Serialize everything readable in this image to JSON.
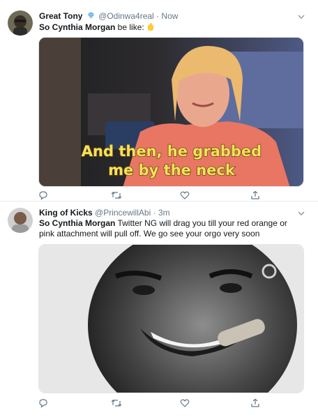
{
  "tweets": [
    {
      "display_name": "Great Tony",
      "handle": "@Odinwa4real",
      "separator": "·",
      "time": "Now",
      "verified_icon": "diamond-icon",
      "text_bold": "So Cynthia Morgan",
      "text_rest": " be like:",
      "emoji_icon": "pointing-hand-icon",
      "media": {
        "caption_line1": "And then, he grabbed",
        "caption_line2": "me by the neck"
      }
    },
    {
      "display_name": "King of Kicks",
      "handle": "@PrincewillAbi",
      "separator": "·",
      "time": "3m",
      "text_bold": "So Cynthia Morgan",
      "text_rest": " Twitter NG will drag you till your red orange or pink attachment will pull off. We go see your orgo very soon"
    }
  ],
  "icons": {
    "reply": "reply-icon",
    "retweet": "retweet-icon",
    "like": "heart-icon",
    "share": "share-icon",
    "menu": "chevron-down-icon"
  },
  "colors": {
    "text": "#14171a",
    "muted": "#657786",
    "verified": "#5aaeea"
  }
}
